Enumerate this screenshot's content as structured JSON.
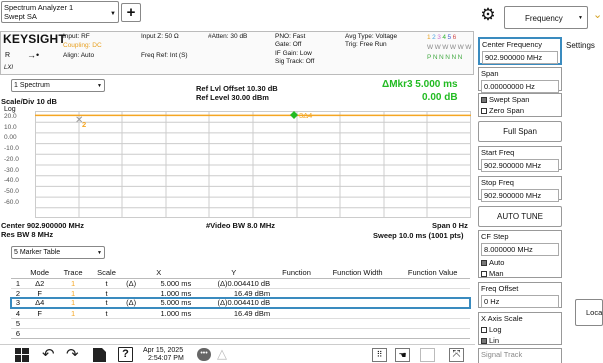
{
  "app": {
    "title_line1": "Spectrum Analyzer 1",
    "title_line2": "Swept SA",
    "add_label": "+"
  },
  "settings": {
    "brand": "KEYSIGHT",
    "input": "Input: RF",
    "coupling": "Coupling: DC",
    "align": "Align: Auto",
    "r_label": "R",
    "lxi": "LXI",
    "input_z": "Input Z: 50 Ω",
    "freq_ref": "Freq Ref: Int (S)",
    "atten": "#Atten: 30 dB",
    "pno": "PNO: Fast",
    "gate": "Gate: Off",
    "if_gain": "IF Gain: Low",
    "sig_track": "Sig Track: Off",
    "avg_type": "Avg Type: Voltage",
    "trig": "Trig: Free Run",
    "trace_nums": [
      "1",
      "2",
      "3",
      "4",
      "5",
      "6"
    ],
    "trace_types": [
      "W",
      "W",
      "W",
      "W",
      "W",
      "W"
    ],
    "trace_dets": [
      "P",
      "N",
      "N",
      "N",
      "N",
      "N"
    ]
  },
  "display": {
    "view": "1 Spectrum",
    "ref_offset": "Ref Lvl Offset 10.30 dB",
    "ref_level": "Ref Level 30.00 dBm",
    "marker_label": "ΔMkr3  5.000 ms",
    "marker_value": "0.00 dB",
    "scale": "Scale/Div 10 dB",
    "log": "Log",
    "y_ticks": [
      "20.0",
      "10.0",
      "0.00",
      "-10.0",
      "-20.0",
      "-30.0",
      "-40.0",
      "-50.0",
      "-60.0"
    ],
    "marker1": "2",
    "marker3": "3Δ4",
    "center": "Center 902.900000 MHz",
    "res_bw": "Res BW 8 MHz",
    "video_bw": "#Video BW 8.0 MHz",
    "span": "Span 0 Hz",
    "sweep": "Sweep 10.0 ms (1001 pts)",
    "trace_color": "#f5a623",
    "marker_color": "#22bb22"
  },
  "marker_table": {
    "title": "5 Marker Table",
    "headers": [
      "Mode",
      "Trace",
      "Scale",
      "X",
      "Y",
      "Function",
      "Function Width",
      "Function Value"
    ],
    "rows": [
      {
        "n": "1",
        "mode": "Δ2",
        "trace": "1",
        "scale": "t",
        "delta": "(Δ)",
        "x": "5.000 ms",
        "y": "(Δ)0.004410 dB"
      },
      {
        "n": "2",
        "mode": "F",
        "trace": "1",
        "scale": "t",
        "delta": "",
        "x": "1.000 ms",
        "y": "16.49 dBm"
      },
      {
        "n": "3",
        "mode": "Δ4",
        "trace": "1",
        "scale": "t",
        "delta": "(Δ)",
        "x": "5.000 ms",
        "y": "(Δ)0.004410 dB"
      },
      {
        "n": "4",
        "mode": "F",
        "trace": "1",
        "scale": "t",
        "delta": "",
        "x": "1.000 ms",
        "y": "16.49 dBm"
      },
      {
        "n": "5",
        "mode": "",
        "trace": "",
        "scale": "",
        "delta": "",
        "x": "",
        "y": ""
      },
      {
        "n": "6",
        "mode": "",
        "trace": "",
        "scale": "",
        "delta": "",
        "x": "",
        "y": ""
      }
    ]
  },
  "taskbar": {
    "date": "Apr 15, 2025",
    "time": "2:54:07 PM"
  },
  "right_panel": {
    "menu": "Frequency",
    "tab": "Settings",
    "side_button": "Loca",
    "center_freq_label": "Center Frequency",
    "center_freq_value": "902.900000 MHz",
    "span_label": "Span",
    "span_value": "0.00000000 Hz",
    "swept_span": "Swept Span",
    "zero_span": "Zero Span",
    "full_span": "Full Span",
    "start_label": "Start Freq",
    "start_value": "902.900000 MHz",
    "stop_label": "Stop Freq",
    "stop_value": "902.900000 MHz",
    "auto_tune": "AUTO TUNE",
    "cf_step_label": "CF Step",
    "cf_step_value": "8.000000 MHz",
    "auto": "Auto",
    "man": "Man",
    "freq_offset_label": "Freq Offset",
    "freq_offset_value": "0 Hz",
    "x_axis_label": "X Axis Scale",
    "log": "Log",
    "lin": "Lin",
    "signal_track": "Signal Track"
  }
}
